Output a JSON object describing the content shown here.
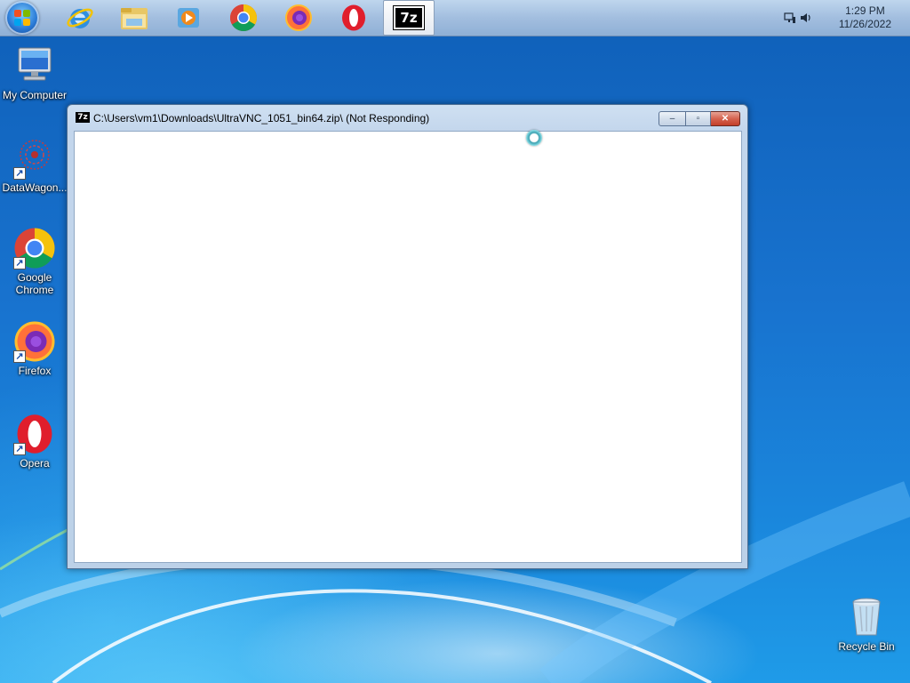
{
  "taskbar": {
    "start_button": "start-orb",
    "pinned_apps": [
      {
        "name": "Internet Explorer",
        "icon": "internet-explorer-icon"
      },
      {
        "name": "Windows Explorer",
        "icon": "folder-icon"
      },
      {
        "name": "Windows Media Player",
        "icon": "media-player-icon"
      },
      {
        "name": "Google Chrome",
        "icon": "chrome-icon"
      },
      {
        "name": "Firefox",
        "icon": "firefox-icon"
      },
      {
        "name": "Opera",
        "icon": "opera-icon"
      },
      {
        "name": "7-Zip File Manager",
        "icon": "seven-zip-icon",
        "icon_text": "7z"
      }
    ],
    "clock": {
      "time": "1:29 PM",
      "date": "11/26/2022"
    }
  },
  "desktop": {
    "icons": [
      {
        "label": "My Computer",
        "icon": "computer-icon"
      },
      {
        "label": "DataWagon...",
        "icon": "datawagon-icon"
      },
      {
        "label": "Google Chrome",
        "icon": "chrome-icon"
      },
      {
        "label": "Firefox",
        "icon": "firefox-icon"
      },
      {
        "label": "Opera",
        "icon": "opera-icon"
      },
      {
        "label": "Recycle Bin",
        "icon": "recycle-bin-icon"
      }
    ]
  },
  "window": {
    "icon_text": "7z",
    "title": "C:\\Users\\vm1\\Downloads\\UltraVNC_1051_bin64.zip\\ (Not Responding)",
    "minimize": "–",
    "maximize": "▫",
    "close": "✕"
  },
  "colors": {
    "desktop_blue": "#1873cf",
    "close_red": "#c33f2a"
  }
}
